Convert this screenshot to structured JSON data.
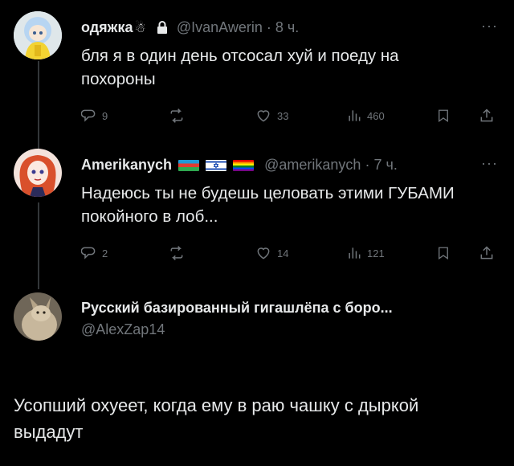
{
  "tweets": [
    {
      "name": "одяжка",
      "name_emoji": "☃",
      "handle": "@IvanAwerin",
      "time": "· 8 ч.",
      "more": "···",
      "text": "бля я в один день отсосал хуй и поеду на похороны",
      "replies": "9",
      "retweets": "",
      "likes": "33",
      "views": "460"
    },
    {
      "name": "Amerikanych",
      "handle": "@amerikanych",
      "time": "· 7 ч.",
      "more": "···",
      "text": "Надеюсь ты не будешь целовать этими ГУБАМИ покойного в лоб...",
      "replies": "2",
      "retweets": "",
      "likes": "14",
      "views": "121"
    },
    {
      "name": "Русский базированный гигашлёпа с боро...",
      "handle": "@AlexZap14",
      "text": "Усопший охуеет, когда ему в раю чашку с дыркой выдадут"
    }
  ],
  "colors": {
    "background": "#000000",
    "text": "#e7e9ea",
    "muted": "#71767b",
    "thread_line": "#333639"
  },
  "icons": [
    "reply-icon",
    "retweet-icon",
    "like-icon",
    "views-icon",
    "bookmark-icon",
    "share-icon",
    "lock-icon"
  ]
}
